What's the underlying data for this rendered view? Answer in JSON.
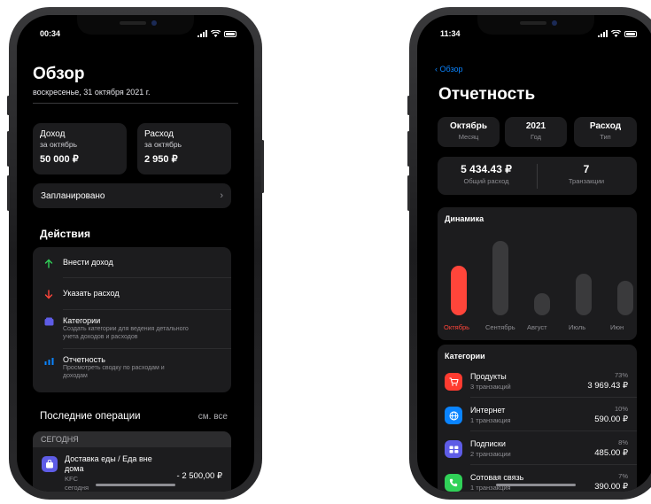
{
  "left_screen": {
    "status_time": "00:34",
    "title": "Обзор",
    "date": "воскресенье, 31 октября 2021 г.",
    "income": {
      "title": "Доход",
      "period": "за октябрь",
      "value": "50 000 ₽"
    },
    "expense": {
      "title": "Расход",
      "period": "за октябрь",
      "value": "2 950 ₽"
    },
    "planned": {
      "label": "Запланировано",
      "chevron": "›"
    },
    "actions_title": "Действия",
    "actions": [
      {
        "label": "Внести доход",
        "icon": "arrow-up-icon",
        "color": "#30d158"
      },
      {
        "label": "Указать расход",
        "icon": "arrow-down-icon",
        "color": "#ff453a"
      },
      {
        "label": "Категории",
        "desc": "Создать категории для ведения детального учета доходов и расходов",
        "icon": "folder-icon",
        "color": "#5e5ce6"
      },
      {
        "label": "Отчетность",
        "desc": "Просмотреть сводку по расходам и доходам",
        "icon": "bar-chart-icon",
        "color": "#0a84ff"
      }
    ],
    "recent_title": "Последние операции",
    "see_all": "см. все",
    "day_label": "СЕГОДНЯ",
    "transaction": {
      "name": "Доставка еды / Еда вне дома",
      "merchant": "KFC",
      "date": "сегодня",
      "amount": "- 2 500,00 ₽"
    }
  },
  "right_screen": {
    "status_time": "11:34",
    "back_label": "Обзор",
    "title": "Отчетность",
    "filters": [
      {
        "value": "Октябрь",
        "label": "Месяц"
      },
      {
        "value": "2021",
        "label": "Год"
      },
      {
        "value": "Расход",
        "label": "Тип"
      }
    ],
    "total": {
      "value": "5 434.43 ₽",
      "label": "Общий расход"
    },
    "count": {
      "value": "7",
      "label": "Транзакции"
    },
    "dynamics_title": "Динамика",
    "chart_data": {
      "type": "bar",
      "title": "Динамика",
      "categories": [
        "Октябрь",
        "Сентябрь",
        "Август",
        "Июль",
        "Июн"
      ],
      "values": [
        5434.43,
        8100,
        2400,
        4500,
        3800
      ],
      "highlight_index": 0,
      "highlight_color": "#ff453a",
      "bar_color": "#3a3a3c"
    },
    "categories_title": "Категории",
    "categories": [
      {
        "name": "Продукты",
        "sub": "3 транзакций",
        "pct": "73%",
        "amount": "3 969.43 ₽",
        "icon": "cart-icon",
        "color": "#ff3b30"
      },
      {
        "name": "Интернет",
        "sub": "1 транзакция",
        "pct": "10%",
        "amount": "590.00 ₽",
        "icon": "globe-icon",
        "color": "#0a84ff"
      },
      {
        "name": "Подписки",
        "sub": "2 транзакции",
        "pct": "8%",
        "amount": "485.00 ₽",
        "icon": "subscription-icon",
        "color": "#5e5ce6"
      },
      {
        "name": "Сотовая связь",
        "sub": "1 транзакция",
        "pct": "7%",
        "amount": "390.00 ₽",
        "icon": "phone-icon",
        "color": "#30d158"
      }
    ]
  }
}
